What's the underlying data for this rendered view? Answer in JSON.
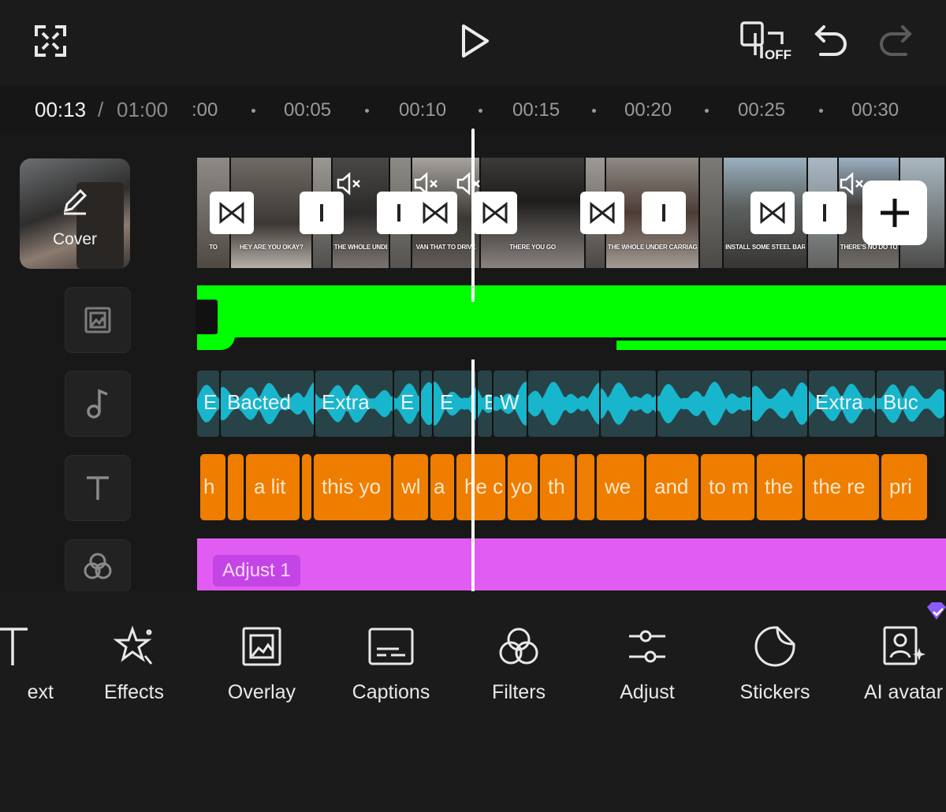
{
  "timecode": {
    "current": "00:13",
    "separator": "/",
    "duration": "01:00"
  },
  "ruler": {
    "ticks": [
      ":00",
      "00:05",
      "00:10",
      "00:15",
      "00:20",
      "00:25",
      "00:30"
    ]
  },
  "top_bar": {
    "sync_badge": "OFF"
  },
  "cover": {
    "label": "Cover"
  },
  "video_captions": [
    "TO",
    "HEY ARE YOU OKAY?",
    "",
    "THE WHOLE UNDE IS RU",
    "",
    "VAN THAT TO DRIVE",
    "THERE YOU GO",
    "",
    "THE WHOLE UNDER CARRIAGE IS RUSTED",
    "",
    "INSTALL SOME STEEL BARS UNDERNEATH IT",
    "",
    "THERE'S NO DO TO FIX IT",
    ""
  ],
  "audio_clips": [
    "E",
    "Bacted",
    "Extra",
    "E",
    "",
    "E",
    "E",
    "W",
    "",
    "",
    "",
    "",
    "Extra",
    "Buc"
  ],
  "text_clips": [
    "h",
    "",
    "a lit",
    "",
    "this yo",
    "wl",
    "a",
    "he c",
    "yo",
    "th",
    "",
    "we",
    "and",
    "to m",
    "the",
    "the re",
    "pri"
  ],
  "adjust_label": "Adjust 1",
  "toolbar": {
    "items": [
      {
        "label": "ext",
        "icon": "text-icon"
      },
      {
        "label": "Effects",
        "icon": "effects-icon"
      },
      {
        "label": "Overlay",
        "icon": "overlay-icon"
      },
      {
        "label": "Captions",
        "icon": "captions-icon"
      },
      {
        "label": "Filters",
        "icon": "filters-icon"
      },
      {
        "label": "Adjust",
        "icon": "adjust-icon"
      },
      {
        "label": "Stickers",
        "icon": "stickers-icon"
      },
      {
        "label": "AI avatar",
        "icon": "ai-avatar-icon"
      }
    ]
  },
  "colors": {
    "accent_green": "#00ff00",
    "audio_wave": "#17b6cc",
    "text_clip": "#ef7d00",
    "adjust_clip": "#e15cf2",
    "premium_badge": "#8a5cff"
  }
}
